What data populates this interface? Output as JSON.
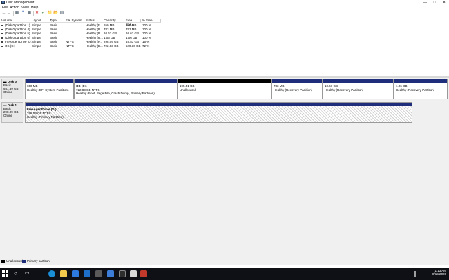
{
  "window": {
    "title": "Disk Management",
    "controls": [
      "—",
      "□",
      "✕"
    ]
  },
  "menu": [
    "File",
    "Action",
    "View",
    "Help"
  ],
  "toolbar": {
    "buttons": [
      "←",
      "→",
      "▦",
      "?",
      "▦",
      "✕",
      "✓",
      "📁",
      "📂",
      "▤"
    ]
  },
  "volume_table": {
    "columns": [
      "Volume",
      "Layout",
      "Type",
      "File System",
      "Status",
      "Capacity",
      "Free Spa...",
      "% Free"
    ],
    "rows": [
      [
        "(Disk 0 partition 1)",
        "Simple",
        "Basic",
        "",
        "Healthy (E...",
        "650 MB",
        "650 MB",
        "100 %"
      ],
      [
        "(Disk 0 partition 4)",
        "Simple",
        "Basic",
        "",
        "Healthy (R...",
        "783 MB",
        "783 MB",
        "100 %"
      ],
      [
        "(Disk 0 partition 5)",
        "Simple",
        "Basic",
        "",
        "Healthy (R...",
        "10.67 GB",
        "10.67 GB",
        "100 %"
      ],
      [
        "(Disk 0 partition 6)",
        "Simple",
        "Basic",
        "",
        "Healthy (R...",
        "1.06 GB",
        "1.06 GB",
        "100 %"
      ],
      [
        "FreeAgentDrive (D:)",
        "Simple",
        "Basic",
        "NTFS",
        "Healthy (P...",
        "298.09 GB",
        "45.83 GB",
        "15 %"
      ],
      [
        "OS (C:)",
        "Simple",
        "Basic",
        "NTFS",
        "Healthy (B...",
        "722.83 GB",
        "520.30 GB",
        "72 %"
      ]
    ]
  },
  "disks": [
    {
      "name": "Disk 0",
      "kind": "Basic",
      "size": "931.39 GB",
      "state": "Online",
      "partitions": [
        {
          "title": "",
          "size": "650 MB",
          "status": "Healthy (EFI System Partition)",
          "unallocated": false
        },
        {
          "title": "OS (C:)",
          "size": "722.83 GB NTFS",
          "status": "Healthy (Boot, Page File, Crash Dump, Primary Partition)",
          "unallocated": false
        },
        {
          "title": "",
          "size": "195.51 GB",
          "status": "Unallocated",
          "unallocated": true
        },
        {
          "title": "",
          "size": "783 MB",
          "status": "Healthy (Recovery Partition)",
          "unallocated": false
        },
        {
          "title": "",
          "size": "10.67 GB",
          "status": "Healthy (Recovery Partition)",
          "unallocated": false
        },
        {
          "title": "",
          "size": "1.06 GB",
          "status": "Healthy (Recovery Partition)",
          "unallocated": false
        }
      ]
    },
    {
      "name": "Disk 1",
      "kind": "Basic",
      "size": "298.09 GB",
      "state": "Online",
      "partitions": [
        {
          "title": "FreeAgentDrive (D:)",
          "size": "298.09 GB NTFS",
          "status": "Healthy (Primary Partition)",
          "unallocated": false
        }
      ]
    }
  ],
  "legend": [
    {
      "label": "Unallocated",
      "color": "#000000"
    },
    {
      "label": "Primary partition",
      "color": "#1f2e7a"
    }
  ],
  "taskbar": {
    "icons": [
      "windows-icon",
      "search-icon",
      "task-view-icon",
      "edge-icon",
      "explorer-icon",
      "store-icon",
      "mail-icon",
      "settings-icon",
      "photos-icon",
      "terminal-icon",
      "app-icon"
    ],
    "time": "1:13 AM",
    "date": "8/19/2020"
  },
  "colors": {
    "primary_partition": "#1f2e7a",
    "unallocated": "#000000",
    "taskbar": "#0e1016"
  }
}
